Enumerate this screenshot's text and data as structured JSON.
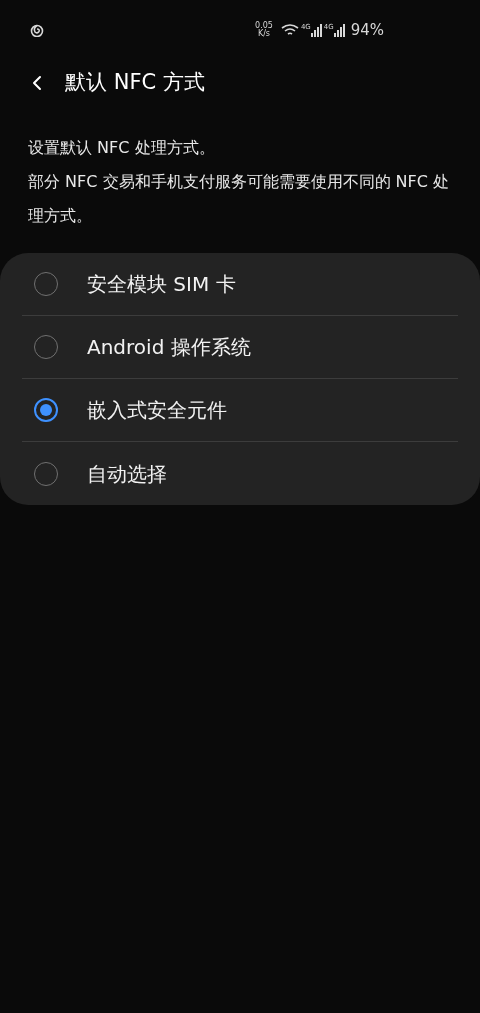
{
  "status_bar": {
    "speed_value": "0.05",
    "speed_unit": "K/s",
    "networks": [
      {
        "label": "4G"
      },
      {
        "label": "4G"
      }
    ],
    "battery": "94%"
  },
  "header": {
    "title": "默认 NFC 方式"
  },
  "description": [
    "设置默认 NFC 处理方式。",
    "部分 NFC 交易和手机支付服务可能需要使用不同的 NFC 处理方式。"
  ],
  "options": [
    {
      "label": "安全模块 SIM 卡",
      "selected": false
    },
    {
      "label": "Android 操作系统",
      "selected": false
    },
    {
      "label": "嵌入式安全元件",
      "selected": true
    },
    {
      "label": "自动选择",
      "selected": false
    }
  ]
}
